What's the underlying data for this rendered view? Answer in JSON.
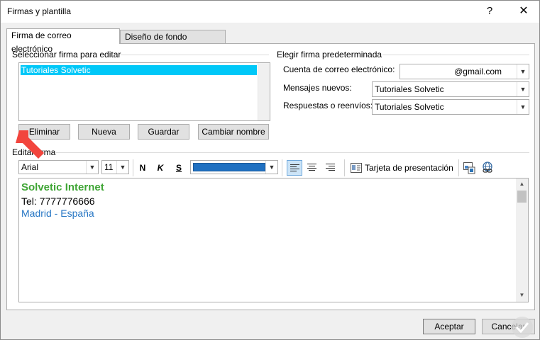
{
  "window": {
    "title": "Firmas y plantilla",
    "help_glyph": "?",
    "close_glyph": "✕"
  },
  "tabs": [
    {
      "label": "Firma de correo electrónico",
      "active": true
    },
    {
      "label": "Diseño de fondo personal",
      "active": false
    }
  ],
  "select_signature": {
    "label": "Seleccionar firma para editar",
    "items": [
      "Tutoriales Solvetic"
    ],
    "selected_index": 0
  },
  "signature_buttons": {
    "delete": "Eliminar",
    "new": "Nueva",
    "save": "Guardar",
    "rename": "Cambiar nombre"
  },
  "default_signature": {
    "label": "Elegir firma predeterminada",
    "account_label": "Cuenta de correo electrónico:",
    "account_value": "@gmail.com",
    "new_messages_label": "Mensajes nuevos:",
    "new_messages_value": "Tutoriales Solvetic",
    "replies_label": "Respuestas o reenvíos:",
    "replies_value": "Tutoriales Solvetic"
  },
  "edit_signature": {
    "label": "Editar firma",
    "font_value": "Arial",
    "size_value": "11",
    "bold": "N",
    "italic": "K",
    "underline": "S",
    "text_color": "#1f70c1",
    "business_card": "Tarjeta de presentación",
    "lines": [
      {
        "text": "Solvetic Internet",
        "color": "#3fa535"
      },
      {
        "text": "Tel: 7777776666",
        "color": "#000000"
      },
      {
        "text": "Madrid - España",
        "color": "#2676c4"
      }
    ]
  },
  "footer": {
    "ok": "Aceptar",
    "cancel": "Cancelar"
  },
  "colors": {
    "selection": "#00c8f8",
    "annotation_arrow": "#f2453d"
  }
}
